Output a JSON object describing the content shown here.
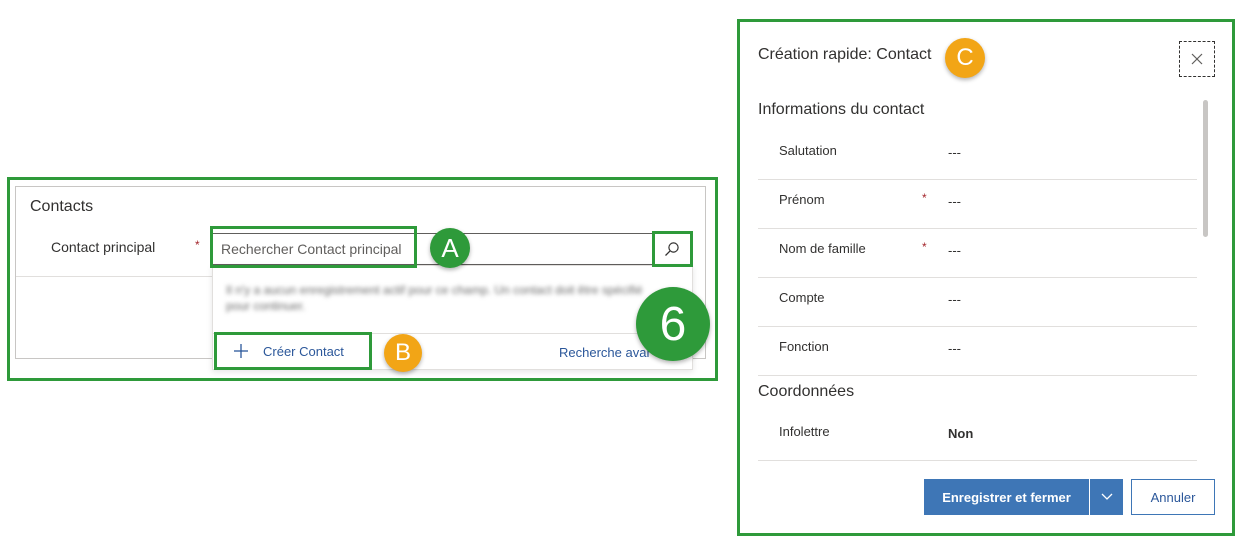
{
  "left_form": {
    "section_title": "Contacts",
    "field_label": "Contact principal",
    "required_mark": "*",
    "search_placeholder": "Rechercher Contact principal",
    "dropdown_message": "Il n'y a aucun enregistrement actif pour ce champ. Un contact doit être spécifié pour continuer.",
    "create_label": "Créer Contact",
    "advanced_search_label": "Recherche avancée"
  },
  "markers": {
    "a": "A",
    "b": "B",
    "c": "C",
    "step": "6"
  },
  "quick_create": {
    "title": "Création rapide: Contact",
    "section1_title": "Informations du contact",
    "section2_title": "Coordonnées",
    "fields": [
      {
        "label": "Salutation",
        "required": "",
        "value": "---"
      },
      {
        "label": "Prénom",
        "required": "*",
        "value": "---"
      },
      {
        "label": "Nom de famille",
        "required": "*",
        "value": "---"
      },
      {
        "label": "Compte",
        "required": "",
        "value": "---"
      },
      {
        "label": "Fonction",
        "required": "",
        "value": "---"
      }
    ],
    "contact_fields": [
      {
        "label": "Infolettre",
        "value": "Non"
      }
    ],
    "save_label": "Enregistrer et fermer",
    "cancel_label": "Annuler"
  },
  "colors": {
    "highlight_green": "#2e9a3a",
    "marker_orange": "#f2a516",
    "primary_blue": "#3e76b6",
    "link_blue": "#2b579a",
    "required_red": "#a4262c"
  },
  "icons": {
    "search": "search-icon",
    "plus": "plus-icon",
    "close": "close-icon",
    "chevron": "chevron-down-icon"
  }
}
